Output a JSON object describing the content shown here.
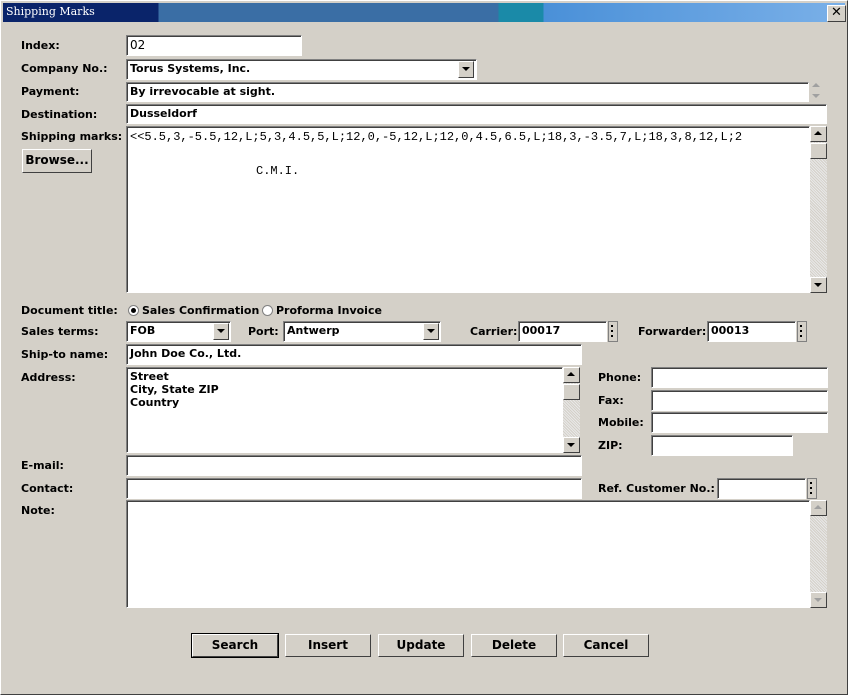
{
  "window": {
    "title": "Shipping Marks",
    "close_glyph": "✕"
  },
  "fields": {
    "index": {
      "label": "Index:",
      "value": "02"
    },
    "company_no": {
      "label": "Company No.:",
      "value": "Torus Systems, Inc."
    },
    "payment": {
      "label": "Payment:",
      "value": "By irrevocable at sight."
    },
    "destination": {
      "label": "Destination:",
      "value": "Dusseldorf"
    },
    "shipping_marks": {
      "label": "Shipping marks:",
      "line1": "<<5.5,3,-5.5,12,L;5,3,4.5,5,L;12,0,-5,12,L;12,0,4.5,6.5,L;18,3,-3.5,7,L;18,3,8,12,L;2",
      "line2": "C.M.I."
    },
    "browse_button": "Browse...",
    "document_title": {
      "label": "Document title:",
      "option1": "Sales Confirmation",
      "option2": "Proforma Invoice",
      "selected": "Sales Confirmation"
    },
    "sales_terms": {
      "label": "Sales terms:",
      "value": "FOB"
    },
    "port": {
      "label": "Port:",
      "value": "Antwerp"
    },
    "carrier": {
      "label": "Carrier:",
      "value": "00017"
    },
    "forwarder": {
      "label": "Forwarder:",
      "value": "00013"
    },
    "ship_to_name": {
      "label": "Ship-to name:",
      "value": "John Doe Co., Ltd."
    },
    "address": {
      "label": "Address:",
      "line1": "Street",
      "line2": "City, State ZIP",
      "line3": "Country"
    },
    "phone": {
      "label": "Phone:",
      "value": ""
    },
    "fax": {
      "label": "Fax:",
      "value": ""
    },
    "mobile": {
      "label": "Mobile:",
      "value": ""
    },
    "zip": {
      "label": "ZIP:",
      "value": ""
    },
    "email": {
      "label": "E-mail:",
      "value": ""
    },
    "contact": {
      "label": "Contact:",
      "value": ""
    },
    "ref_customer_no": {
      "label": "Ref. Customer No.:",
      "value": ""
    },
    "note": {
      "label": "Note:",
      "value": ""
    }
  },
  "buttons": {
    "search": "Search",
    "insert": "Insert",
    "update": "Update",
    "delete": "Delete",
    "cancel": "Cancel"
  },
  "colors": {
    "titlebar": "#0a246a",
    "face": "#d4d0c8"
  }
}
